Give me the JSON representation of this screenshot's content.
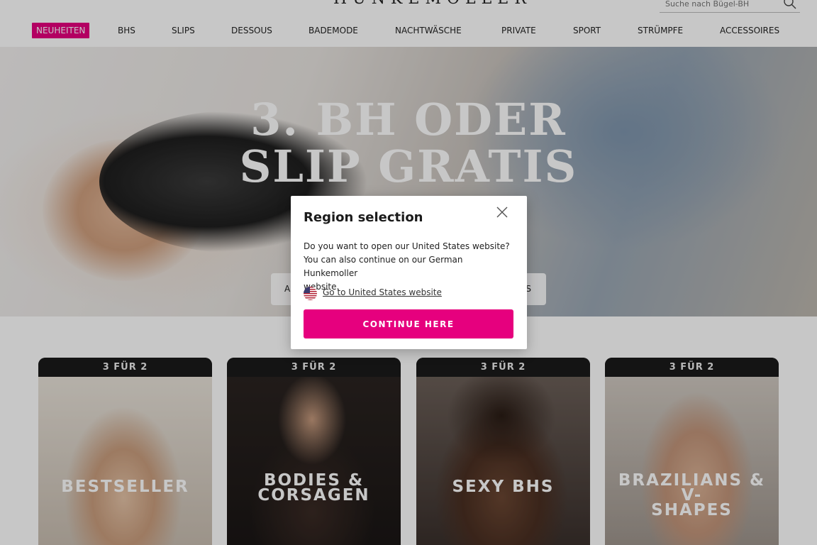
{
  "header": {
    "logo": "HUNKEMÖLLER",
    "search_placeholder": "Suche nach Bügel-BH"
  },
  "nav": {
    "items": [
      {
        "label": "NEUHEITEN",
        "active": true
      },
      {
        "label": "BHS"
      },
      {
        "label": "SLIPS"
      },
      {
        "label": "DESSOUS"
      },
      {
        "label": "BADEMODE"
      },
      {
        "label": "NACHTWÄSCHE"
      },
      {
        "label": "PRIVATE"
      },
      {
        "label": "SPORT"
      },
      {
        "label": "STRÜMPFE"
      },
      {
        "label": "ACCESSOIRES"
      }
    ]
  },
  "hero": {
    "title_line1": "3. BH ODER",
    "title_line2": "SLIP GRATIS",
    "cta_left": "A",
    "cta_right": "S"
  },
  "cards": [
    {
      "badge": "3 FÜR 2",
      "label": "BESTSELLER"
    },
    {
      "badge": "3 FÜR 2",
      "label_line1": "BODIES &",
      "label_line2": "CORSAGEN"
    },
    {
      "badge": "3 FÜR 2",
      "label": "SEXY BHS"
    },
    {
      "badge": "3 FÜR 2",
      "label_line1": "BRAZILIANS & V-",
      "label_line2": "SHAPES"
    }
  ],
  "modal": {
    "title": "Region selection",
    "text_line1": "Do you want to open our United States website?",
    "text_line2": "You can also continue on our German Hunkemoller",
    "text_line3": "website.",
    "link": "Go to United States website",
    "button": "CONTINUE HERE"
  },
  "colors": {
    "brand_pink": "#e6007e"
  }
}
